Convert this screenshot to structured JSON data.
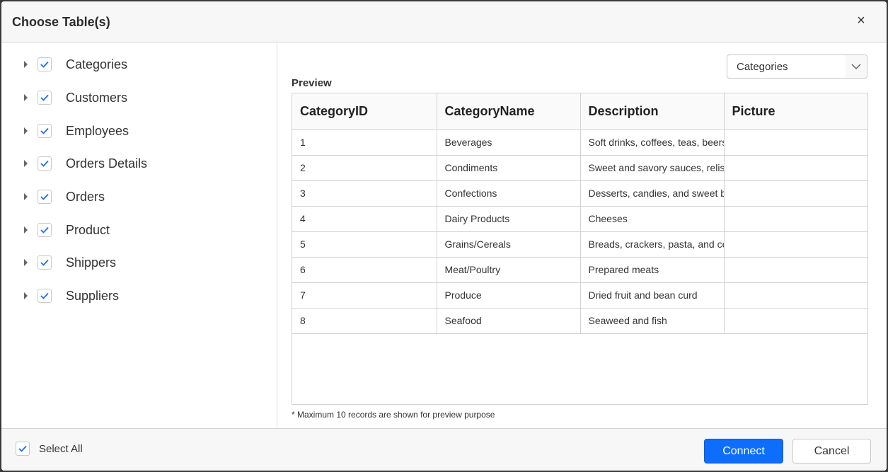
{
  "dialog": {
    "title": "Choose Table(s)",
    "close_icon": "close-icon"
  },
  "tables": [
    {
      "label": "Categories",
      "checked": true
    },
    {
      "label": "Customers",
      "checked": true
    },
    {
      "label": "Employees",
      "checked": true
    },
    {
      "label": "Orders Details",
      "checked": true
    },
    {
      "label": "Orders",
      "checked": true
    },
    {
      "label": "Product",
      "checked": true
    },
    {
      "label": "Shippers",
      "checked": true
    },
    {
      "label": "Suppliers",
      "checked": true
    }
  ],
  "preview": {
    "label": "Preview",
    "selected_table": "Categories",
    "columns": [
      "CategoryID",
      "CategoryName",
      "Description",
      "Picture"
    ],
    "rows": [
      [
        "1",
        "Beverages",
        "Soft drinks, coffees, teas, beers, and ales",
        ""
      ],
      [
        "2",
        "Condiments",
        "Sweet and savory sauces, relishes, spreads, and seasonings",
        ""
      ],
      [
        "3",
        "Confections",
        "Desserts, candies, and sweet breads",
        ""
      ],
      [
        "4",
        "Dairy Products",
        "Cheeses",
        ""
      ],
      [
        "5",
        "Grains/Cereals",
        "Breads, crackers, pasta, and cereal",
        ""
      ],
      [
        "6",
        "Meat/Poultry",
        "Prepared meats",
        ""
      ],
      [
        "7",
        "Produce",
        "Dried fruit and bean curd",
        ""
      ],
      [
        "8",
        "Seafood",
        "Seaweed and fish",
        ""
      ]
    ],
    "footnote": "* Maximum 10 records are shown for preview purpose"
  },
  "footer": {
    "select_all_label": "Select All",
    "select_all_checked": true,
    "connect_label": "Connect",
    "cancel_label": "Cancel"
  },
  "colors": {
    "accent": "#0d6efd",
    "check": "#1a6ef5"
  }
}
